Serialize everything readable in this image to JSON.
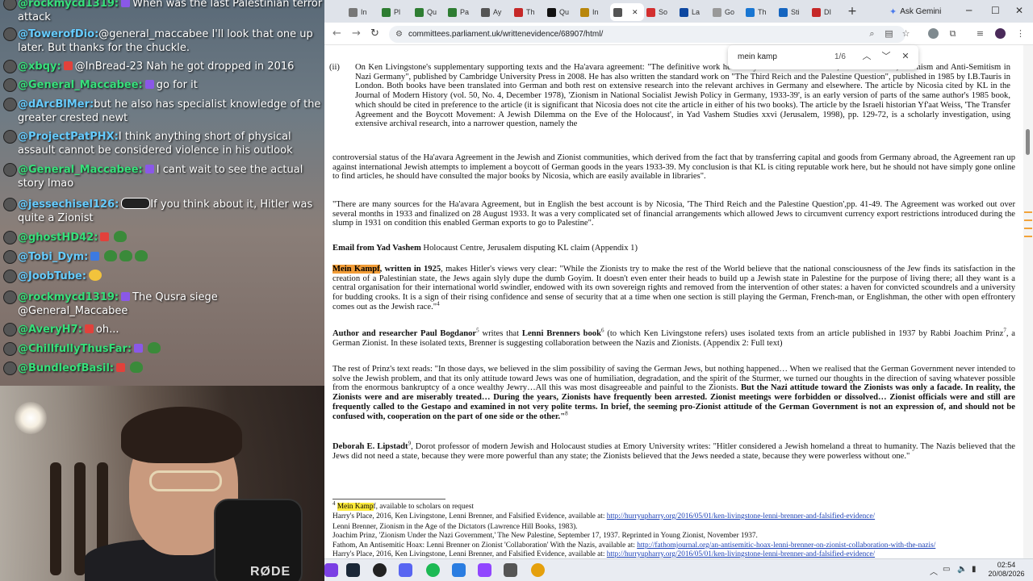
{
  "chat": {
    "messages": [
      {
        "user": "@rockmycd1319:",
        "badge": "purple",
        "text": "When was the last Palestinian terror attack",
        "color": "green"
      },
      {
        "user": "@TowerofDio:",
        "badge": "",
        "text": "@general_maccabee I'll look that one up later. But thanks for the chuckle.",
        "color": "blue"
      },
      {
        "user": "@xbqy:",
        "badge": "red",
        "text": "@InBread-23 Nah he got dropped in 2016",
        "color": "green"
      },
      {
        "user": "@General_Maccabee:",
        "badge": "purple",
        "text": "go for it",
        "color": "green"
      },
      {
        "user": "@dArcBlMer:",
        "badge": "",
        "text": "but he also has specialist knowledge of the greater crested newt",
        "color": "blue"
      },
      {
        "user": "@ProjectPatPHX:",
        "badge": "",
        "text": "I think anything short of physical assault cannot be considered violence in his outlook",
        "color": "blue"
      },
      {
        "user": "@General_Maccabee:",
        "badge": "purple",
        "text": "I cant wait to see the actual story lmao",
        "color": "green"
      },
      {
        "user": "@jessechisel126:",
        "badge": "",
        "text": "If you think about it, Hitler was quite a Zionist",
        "color": "blue"
      },
      {
        "user": "@ghostHD42:",
        "badge": "red",
        "text": "",
        "color": "green"
      },
      {
        "user": "@Tobi_Dym:",
        "badge": "blue",
        "text": "",
        "color": "blue"
      },
      {
        "user": "@JoobTube:",
        "badge": "",
        "text": "",
        "color": "blue"
      },
      {
        "user": "@rockmycd1319:",
        "badge": "purple",
        "text": "The Qusra siege @General_Maccabee",
        "color": "green"
      },
      {
        "user": "@AveryH7:",
        "badge": "red",
        "text": "oh...",
        "color": "green"
      },
      {
        "user": "@ChillfullyThusFar:",
        "badge": "purple",
        "text": "",
        "color": "green"
      },
      {
        "user": "@BundleofBasil:",
        "badge": "red",
        "text": "",
        "color": "green"
      }
    ]
  },
  "camera": {
    "mic_brand": "RØDE"
  },
  "browser": {
    "tabs": [
      "In",
      "Pl",
      "Qu",
      "Pa",
      "Ay",
      "Th",
      "Qu",
      "In",
      "",
      "So",
      "La",
      "Go",
      "Th",
      "Sti",
      "DI"
    ],
    "ask_gemini": "Ask Gemini",
    "url": "committees.parliament.uk/writtenevidence/68907/html/",
    "find": {
      "query": "mein kamp",
      "count": "1/6"
    }
  },
  "document": {
    "para_ii_label": "(ii)",
    "para_ii": "On Ken Livingstone's supplementary supporting texts and the Ha'avara agreement: \"The definitive work here is by an American historian, Francis Nicosia, \"Zionism and Anti-Semitism in Nazi Germany\", published by Cambridge University Press in 2008. He has also written the standard work on \"The Third Reich and the Palestine Question\", published in 1985 by I.B.Tauris in London. Both books have been translated into German and both rest on extensive research into the relevant archives in Germany and elsewhere. The article by Nicosia cited by KL in the Journal of Modern History (vol. 50, No. 4, December 1978), 'Zionism in National Socialist Jewish Policy in Germany, 1933-39', is an early version of parts of the same author's 1985 book, which should be cited in preference to the article (it is significant that Nicosia does not cite the article in either of his two books). The article by the Israeli historian Yf'aat Weiss, 'The Transfer Agreement and the Boycott Movement: A Jewish Dilemma on the Eve of the Holocaust', in Yad Vashem Studies xxvi (Jerusalem, 1998), pp. 129-72, is a scholarly investigation, using extensive archival research, into a narrower question, namely the",
    "para_cont": "controversial status of the Ha'avara Agreement in the Jewish and Zionist communities, which derived from the fact that by transferring capital and goods from Germany abroad, the Agreement ran up against international Jewish attempts to implement a boycott of German goods in the years 1933-39. My conclusion is that KL is citing reputable work here, but he should not have simply gone online to find articles, he should have consulted the major books by Nicosia, which are easily available in libraries\".",
    "para_sources": "\"There are many sources for the Ha'avara Agreement, but in English the best account is by Nicosia, 'The Third Reich and the Palestine Question',pp. 41-49. The Agreement was worked out over several months in 1933 and finalized on 28 August 1933. It was a very complicated set of financial arrangements which allowed Jews to circumvent currency export restrictions introduced during the slump in 1931 on condition this enabled German exports to go to Palestine\".",
    "email_bold": "Email from Yad Vashem",
    "email_rest": " Holocaust Centre, Jerusalem disputing KL claim (Appendix 1)",
    "mk_hl": "Mein Kampf",
    "mk_bold": ", written in 1925",
    "mk_rest": ", makes Hitler's views very clear: \"While the Zionists try to make the rest of the World believe that the national consciousness of the Jew finds its satisfaction in the creation of a Palestinian state, the Jews again slyly dupe the dumb Goyim. It doesn't even enter their heads to build up a Jewish state in Palestine for the purpose of living there; all they want is a central organisation for their international world swindler, endowed with its own sovereign rights and removed from the intervention of other states: a haven for convicted scoundrels and a university for budding crooks. It is a sign of their rising confidence and sense of security that at a time when one section is still playing the German, French-man, or Englishman, the other with open effrontery comes out as the Jewish race.\"",
    "mk_sup": "4",
    "auth_bold": "Author and researcher Paul Bogdanor",
    "auth_sup": "5",
    "auth_mid": " writes that ",
    "auth_bold2": "Lenni Brenners book",
    "auth_sup2": "6",
    "auth_rest": " (to which Ken Livingstone refers) uses isolated texts from an article published in 1937 by Rabbi Joachim Prinz",
    "auth_sup3": "7",
    "auth_rest2": ", a German Zionist. In these isolated texts, Brenner is suggesting collaboration between the Nazis and Zionists. (Appendix 2: Full text)",
    "prinz_text": "The rest of Prinz's text reads: \"In those days, we believed in the slim possibility of saving the German Jews, but nothing happened… When we realised that the German Government never intended to solve the Jewish problem, and that its only attitude toward Jews was one of humiliation, degradation, and the spirit of the Sturmer, we turned our thoughts in the direction of saving whatever possible from the enormous bankruptcy of a once wealthy Jewry…All this was most disagreeable and painful to the Zionists. ",
    "prinz_bold": "But the Nazi attitude toward the Zionists was only a facade. In reality, the Zionists were and are miserably treated… During the years, Zionists have frequently been arrested. Zionist meetings were forbidden or dissolved… Zionist officials were and still are frequently called to the Gestapo and examined in not very polite terms. In brief, the seeming pro-Zionist attitude of the German Government is not an expression of, and should not be confused with, cooperation on the part of one side or the other.\"",
    "prinz_sup": "8",
    "lip_bold": "Deborah E. Lipstadt",
    "lip_sup": "9",
    "lip_rest": ", Dorot professor of modern Jewish and Holocaust studies at Emory University writes: \"Hitler considered a Jewish homeland a threat to humanity. The Nazis believed that the Jews did not need a state, because they were more powerful than any state; the Zionists believed that the Jews needed a state, because they were powerless without one.\"",
    "footnotes": {
      "f4_num": "4",
      "f4_hl": "Mein Kamp",
      "f4_rest": "f, available to scholars on request",
      "f5": "Harry's Place, 2016, Ken Livingstone, Lenni Brenner, and Falsified Evidence, available at: ",
      "f5_link": "http://hurryupharry.org/2016/05/01/ken-livingstone-lenni-brenner-and-falsified-evidence/",
      "f6": "Lenni Brenner, Zionism in the Age of the Dictators (Lawrence Hill Books, 1983).",
      "f7": "Joachim Prinz, 'Zionism Under the Nazi Government,' The New Palestine, September 17, 1937. Reprinted in Young Zionist, November 1937.",
      "f8": "Fathom, An Antisemitic Hoax: Lenni Brenner on Zionist 'Collaboration' With the Nazis, available at: ",
      "f8_link": "http://fathomjournal.org/an-antisemitic-hoax-lenni-brenner-on-zionist-collaboration-with-the-nazis/",
      "f8b": "Harry's Place, 2016, Ken Livingstone, Lenni Brenner, and Falsified Evidence, available at: ",
      "f8b_link": "http://hurryupharry.org/2016/05/01/ken-livingstone-lenni-brenner-and-falsified-evidence/"
    }
  },
  "taskbar": {
    "time": "02:54",
    "date": "20/08/2026"
  }
}
